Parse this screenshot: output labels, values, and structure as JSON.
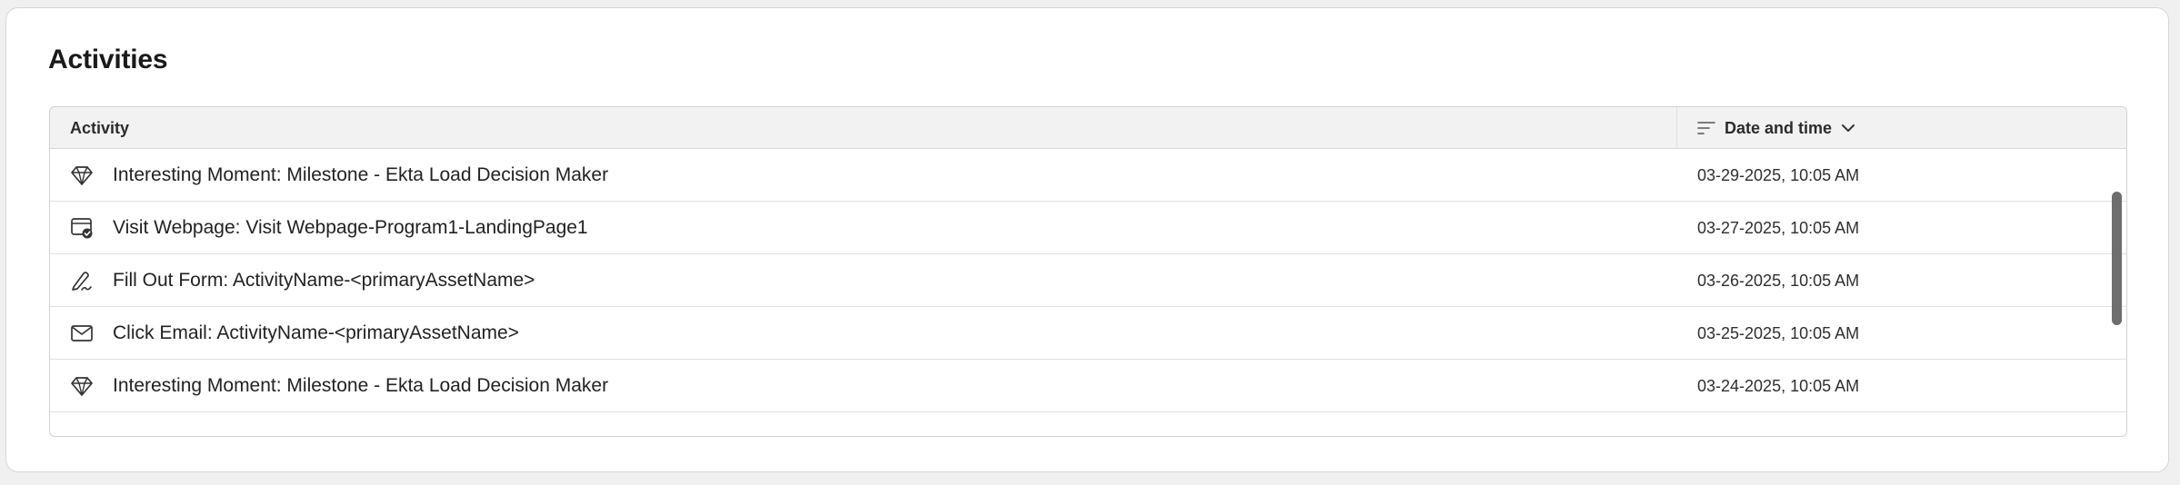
{
  "panel": {
    "title": "Activities"
  },
  "table": {
    "columns": {
      "activity": "Activity",
      "date_time": "Date and time"
    },
    "header_icons": {
      "sort": "sort-icon",
      "chevron": "chevron-down-icon"
    },
    "rows": [
      {
        "icon": "diamond-icon",
        "activity": "Interesting Moment: Milestone - Ekta Load Decision Maker",
        "date": "03-29-2025, 10:05 AM"
      },
      {
        "icon": "webpage-icon",
        "activity": "Visit Webpage: Visit Webpage-Program1-LandingPage1",
        "date": "03-27-2025, 10:05 AM"
      },
      {
        "icon": "form-icon",
        "activity": "Fill Out Form: ActivityName-<primaryAssetName>",
        "date": "03-26-2025, 10:05 AM"
      },
      {
        "icon": "email-icon",
        "activity": "Click Email: ActivityName-<primaryAssetName>",
        "date": "03-25-2025, 10:05 AM"
      },
      {
        "icon": "diamond-icon",
        "activity": "Interesting Moment: Milestone - Ekta Load Decision Maker",
        "date": "03-24-2025, 10:05 AM"
      },
      {
        "icon": "",
        "activity": "",
        "date": ""
      }
    ]
  },
  "colors": {
    "background": "#f0f0f0",
    "card": "#ffffff",
    "header_bg": "#f2f2f2",
    "scrollbar": "#6e6e6e"
  }
}
